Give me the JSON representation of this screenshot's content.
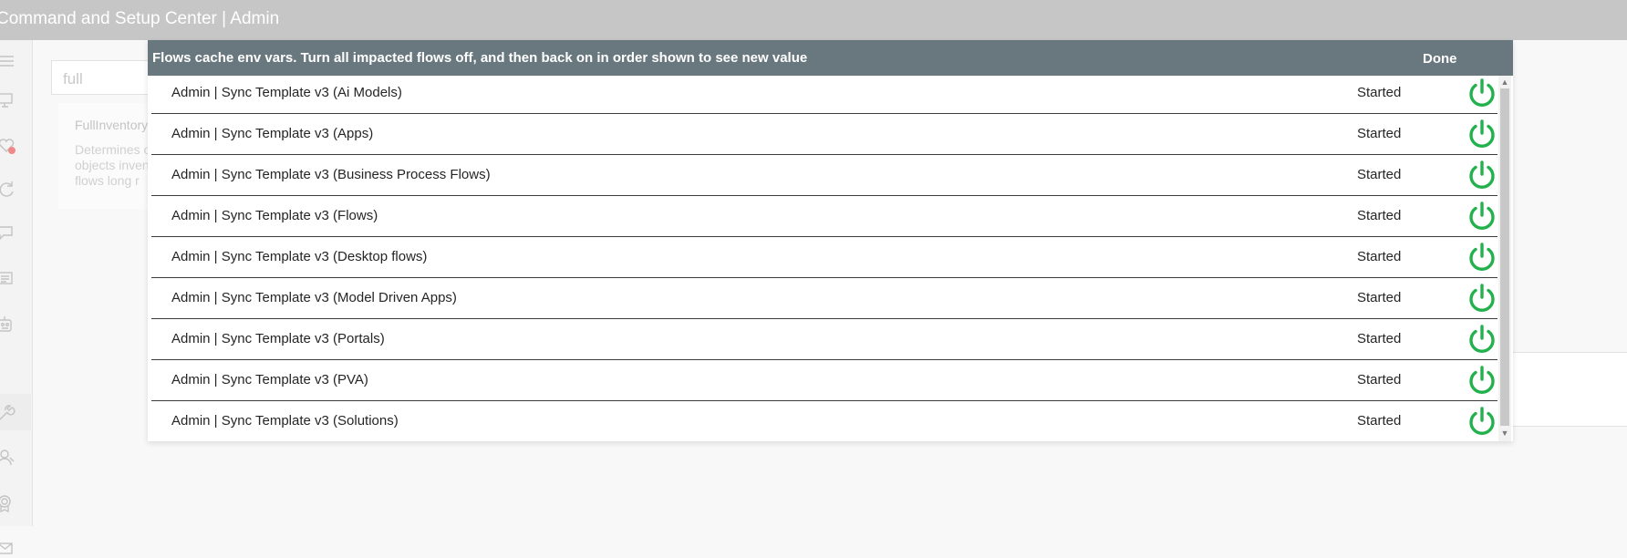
{
  "app": {
    "title": "Command and Setup Center | Admin"
  },
  "search": {
    "value": "full"
  },
  "background_card": {
    "title": "FullInventory",
    "description": "Determines or all objects inventory ev flows long r"
  },
  "dialog": {
    "title": "Flows cache env vars. Turn all impacted flows off, and then back on in order shown to see new value",
    "done_label": "Done",
    "flows": [
      {
        "name": "Admin | Sync Template v3 (Ai Models)",
        "status": "Started"
      },
      {
        "name": "Admin | Sync Template v3 (Apps)",
        "status": "Started"
      },
      {
        "name": "Admin | Sync Template v3 (Business Process Flows)",
        "status": "Started"
      },
      {
        "name": "Admin | Sync Template v3 (Flows)",
        "status": "Started"
      },
      {
        "name": "Admin | Sync Template v3 (Desktop flows)",
        "status": "Started"
      },
      {
        "name": "Admin | Sync Template v3 (Model Driven Apps)",
        "status": "Started"
      },
      {
        "name": "Admin | Sync Template v3 (Portals)",
        "status": "Started"
      },
      {
        "name": "Admin | Sync Template v3 (PVA)",
        "status": "Started"
      },
      {
        "name": "Admin | Sync Template v3 (Solutions)",
        "status": "Started"
      }
    ]
  },
  "nav_icons": [
    "menu-icon",
    "devices-icon",
    "heart-alert-icon",
    "refresh-icon",
    "chat-icon",
    "news-icon",
    "robot-icon",
    "wrench-icon",
    "people-icon",
    "badge-icon",
    "mail-icon"
  ],
  "colors": {
    "topbar": "#c6c6c6",
    "dialog_header": "#69787f",
    "power_on": "#22b14c"
  }
}
